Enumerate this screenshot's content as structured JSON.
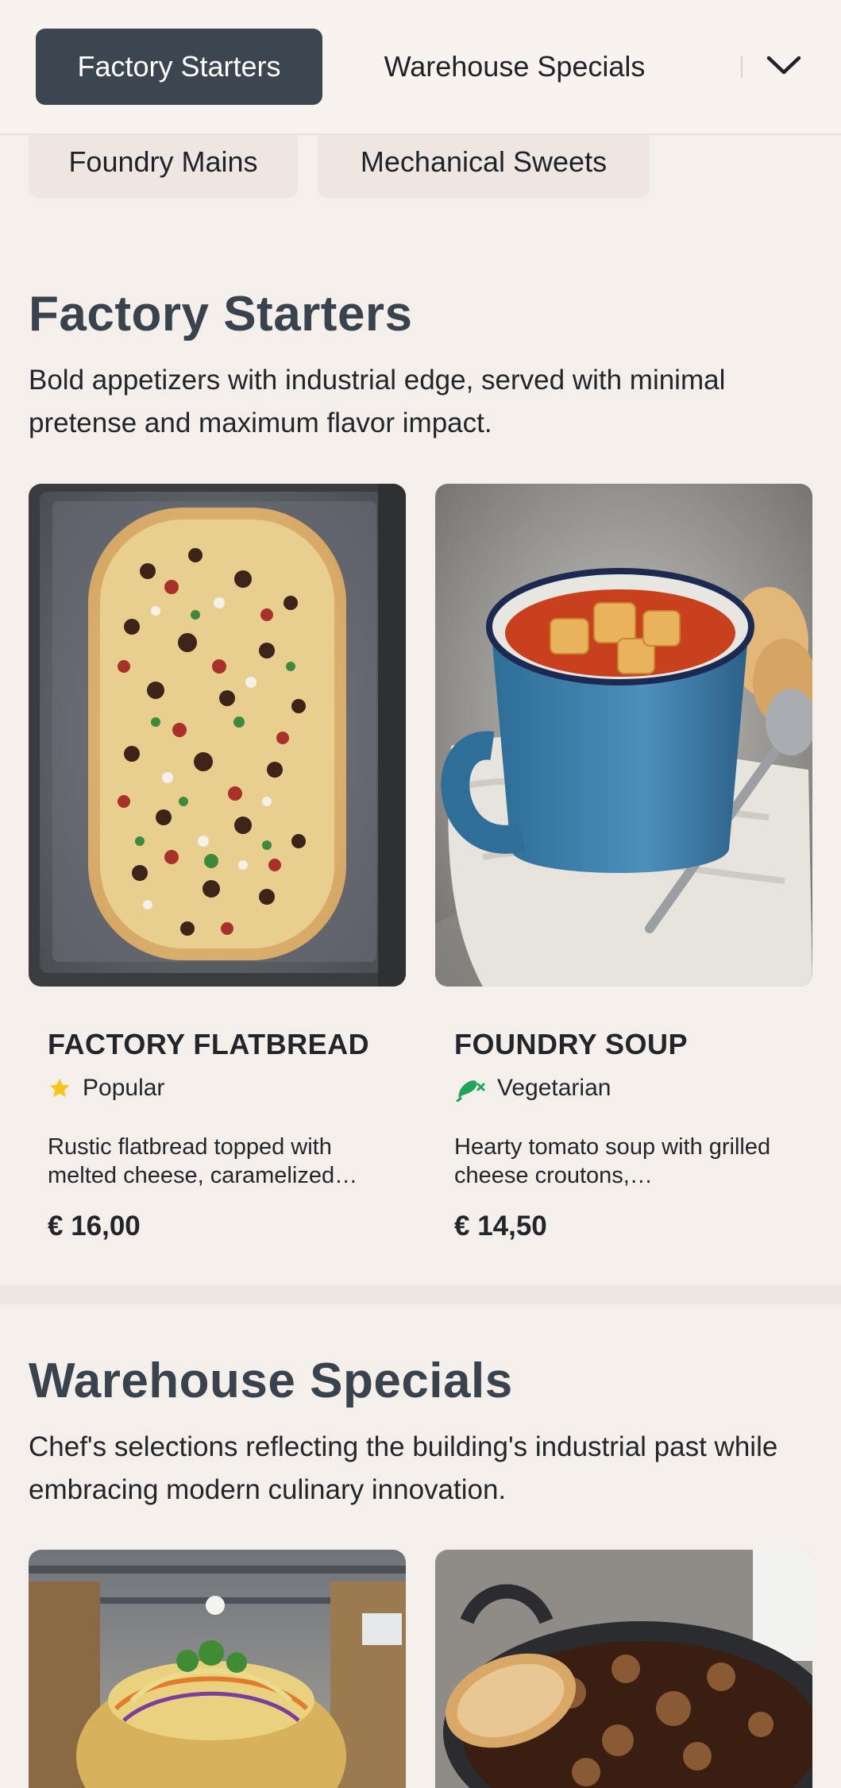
{
  "nav": {
    "tabs": [
      {
        "label": "Factory Starters",
        "active": true
      },
      {
        "label": "Warehouse Specials",
        "active": false
      }
    ],
    "overflow": [
      {
        "label": "Foundry Mains"
      },
      {
        "label": "Mechanical Sweets"
      }
    ],
    "toggle_icon": "chevron-down-icon"
  },
  "sections": [
    {
      "title": "Factory Starters",
      "description": "Bold appetizers with industrial edge, served with minimal pretense and maximum flavor impact.",
      "items": [
        {
          "name": "FACTORY FLATBREAD",
          "badge": "Popular",
          "badge_icon": "star-icon",
          "description": "Rustic flatbread topped with melted cheese, caramelized…",
          "price": "€ 16,00"
        },
        {
          "name": "FOUNDRY SOUP",
          "badge": "Vegetarian",
          "badge_icon": "vegetarian-icon",
          "description": "Hearty tomato soup with grilled cheese croutons,…",
          "price": "€ 14,50"
        }
      ]
    },
    {
      "title": "Warehouse Specials",
      "description": "Chef's selections reflecting the building's industrial past while embracing modern culinary innovation."
    }
  ],
  "colors": {
    "background": "#f5efeb",
    "active_tab": "#3b4650",
    "heading": "#38434d",
    "star": "#f5c518",
    "vegetarian": "#22a55b"
  }
}
